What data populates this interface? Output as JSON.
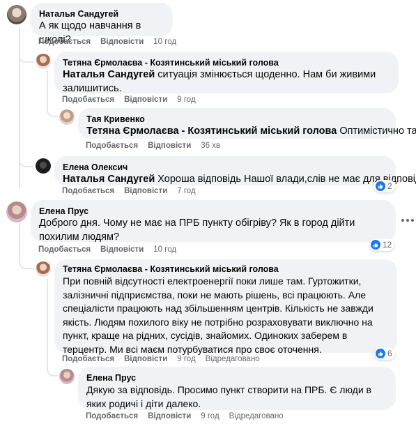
{
  "comments": [
    {
      "author": "Наталья Сандугей",
      "mention": "",
      "text": "А як щодо навчання в школі?",
      "like_label": "Подобається",
      "reply_label": "Відповісти",
      "time": "10 год"
    },
    {
      "author": "Тетяна Єрмолаєва - Козятинський міський голова",
      "mention": "Наталья Сандугей",
      "text": " ситуація змінюється щоденно. Нам би живими залишитись.",
      "like_label": "Подобається",
      "reply_label": "Відповісти",
      "time": "9 год"
    },
    {
      "author": "Тая Кривенко",
      "mention": "Тетяна Єрмолаєва - Козятинський міський голова",
      "text": " Оптимістично так!",
      "like_label": "Подобається",
      "reply_label": "Відповісти",
      "time": "36 хв"
    },
    {
      "author": "Елена Олексич",
      "mention": "Наталья Сандугей",
      "text": " Хороша відповідь Нашої влади,слів не має для відповіді!",
      "like_label": "Подобається",
      "reply_label": "Відповісти",
      "time": "7 год",
      "reactions": "2"
    },
    {
      "author": "Елена Прус",
      "mention": "",
      "text": "Доброго дня. Чому не має на ПРБ пункту обігріву? Як в город дійти похилим людям?",
      "like_label": "Подобається",
      "reply_label": "Відповісти",
      "time": "10 год",
      "reactions": "12"
    },
    {
      "author": "Тетяна Єрмолаєва - Козятинський міський голова",
      "mention": "",
      "text": "При повній відсутності електроенергії поки лише там. Гуртожитки, залізничні підприємства, поки не мають рішень, всі працюють. Але спеціалісти працюють над збільшенням центрів. Кількість не завжди якість. Людям похилого віку не потрібно розраховувати виключно на пункт, краще на рідних, сусідів, знайомих. Одиноких заберем в терцентр. Ми всі маєм потурбуватися про своє оточення.",
      "like_label": "Подобається",
      "reply_label": "Відповісти",
      "time": "9 год",
      "edited": "Відредаговано",
      "reactions": "6"
    },
    {
      "author": "Елена Прус",
      "mention": "",
      "text": "Дякую за відповідь. Просимо пункт створити на ПРБ. Є люди в яких родичі і діти далеко.",
      "like_label": "Подобається",
      "reply_label": "Відповісти",
      "time": "9 год",
      "edited": "Відредаговано"
    }
  ],
  "colors": {
    "bubble": "#f0f2f5",
    "meta": "#65676b",
    "like": "#1877f2",
    "thread": "#e4e6eb"
  },
  "icons": {
    "reaction": "like-icon",
    "menu": "more-dots-icon"
  }
}
